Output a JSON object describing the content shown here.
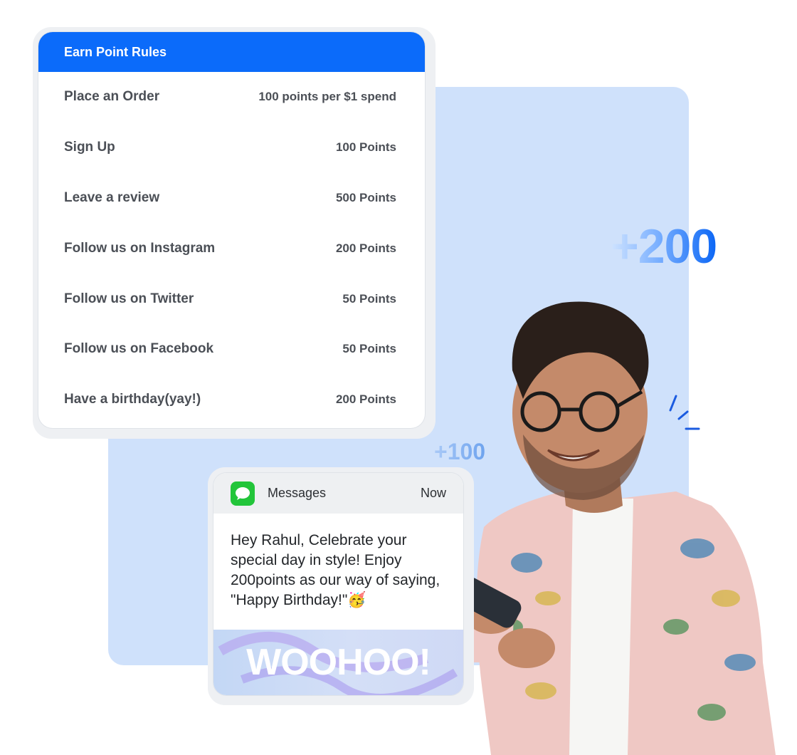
{
  "rules": {
    "title": "Earn Point Rules",
    "items": [
      {
        "name": "Place an Order",
        "points": "100 points per $1 spend"
      },
      {
        "name": "Sign Up",
        "points": "100 Points"
      },
      {
        "name": "Leave a review",
        "points": "500 Points"
      },
      {
        "name": "Follow us on Instagram",
        "points": "200 Points"
      },
      {
        "name": "Follow us on Twitter",
        "points": "50 Points"
      },
      {
        "name": "Follow us on Facebook",
        "points": "50 Points"
      },
      {
        "name": "Have a birthday(yay!)",
        "points": "200 Points"
      }
    ]
  },
  "badges": {
    "large": "+200",
    "small": "+100"
  },
  "message": {
    "app_name": "Messages",
    "time": "Now",
    "icon": "message-bubble-icon",
    "body": "Hey Rahul, Celebrate your special day in style! Enjoy 200points  as our way of saying, \"Happy Birthday!\"🥳",
    "banner_text": "WOOHOO!"
  },
  "colors": {
    "primary": "#0b6bfa",
    "background_panel": "#cfe1fb",
    "messages_green": "#22c53a"
  }
}
